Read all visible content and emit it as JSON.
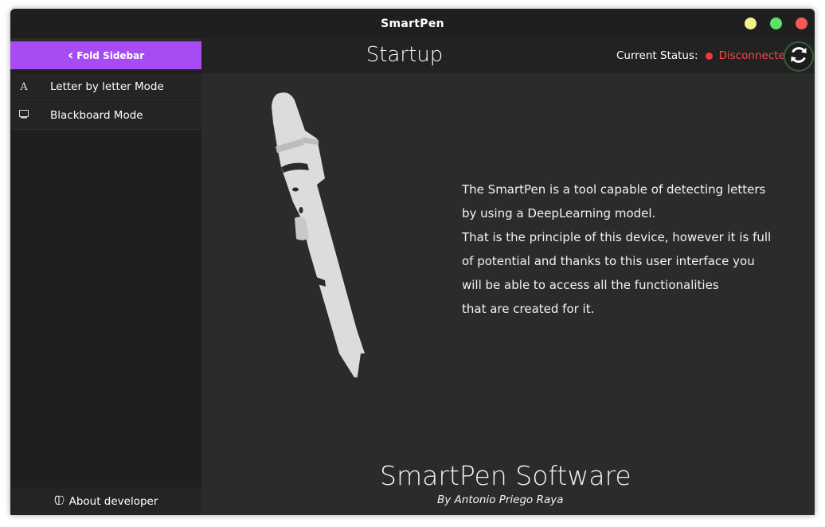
{
  "window": {
    "title": "SmartPen"
  },
  "sidebar": {
    "fold_label": "Fold Sidebar",
    "items": [
      {
        "icon": "letter-a-icon",
        "label": "Letter by letter Mode"
      },
      {
        "icon": "monitor-icon",
        "label": "Blackboard Mode"
      }
    ],
    "about_label": "About developer"
  },
  "header": {
    "title": "Startup",
    "status_label": "Current Status:",
    "status_value": "Disconnected",
    "status_color": "#ff4545"
  },
  "main": {
    "description": [
      "The SmartPen is a tool capable of detecting letters",
      "by using a DeepLearning model.",
      "That is the principle of this device, however it is full",
      "of potential and thanks to this user interface you",
      "will be able to access all the functionalities",
      "that are created for it."
    ],
    "footer_title": "SmartPen Software",
    "footer_subtitle": "By Antonio Priego Raya"
  },
  "colors": {
    "accent": "#a64cf2",
    "background": "#2b2b2b",
    "sidebar": "#1f1f1f"
  }
}
